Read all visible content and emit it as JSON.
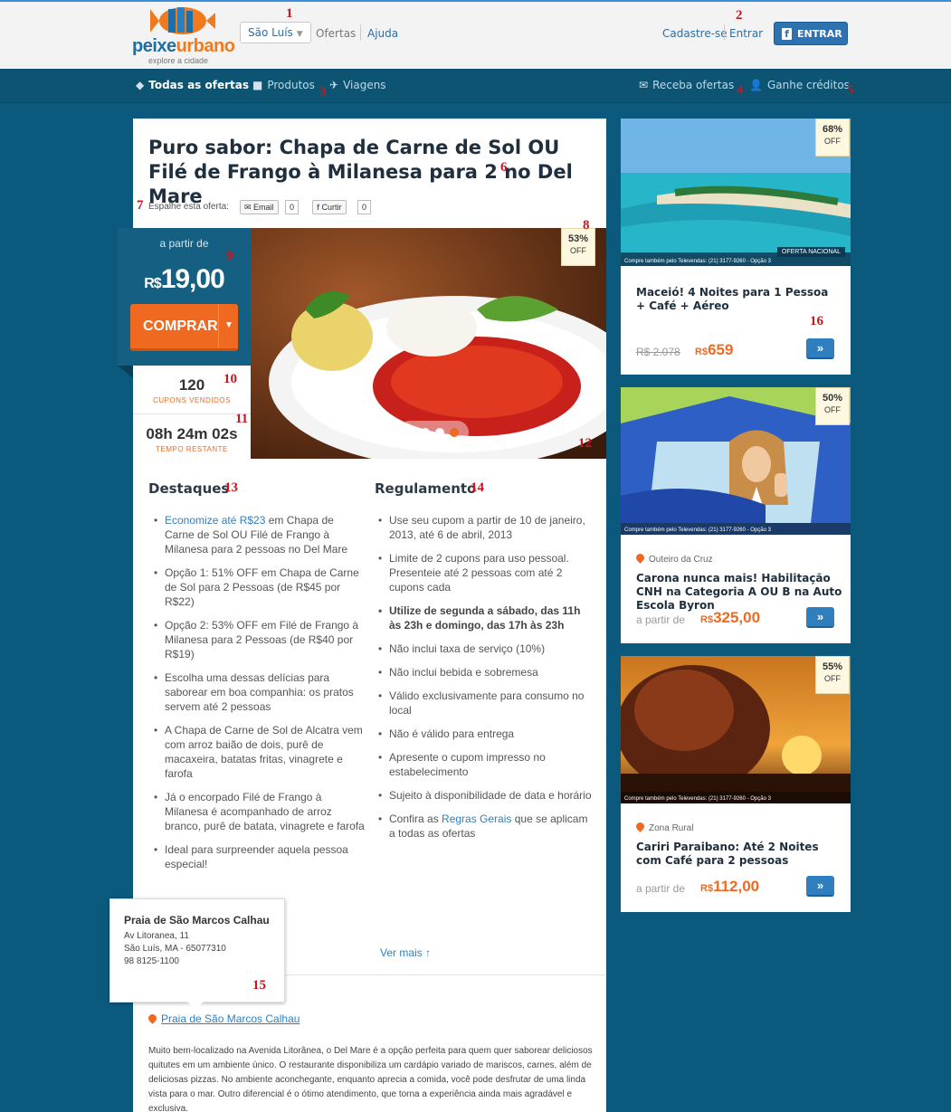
{
  "header": {
    "logo_main_a": "peixe",
    "logo_main_b": "urbano",
    "logo_sub": "explore a cidade",
    "city": "São Luís",
    "ofertas": "Ofertas",
    "ajuda": "Ajuda",
    "cadastre": "Cadastre-se",
    "entrar": "Entrar",
    "entrar_button": "ENTRAR"
  },
  "nav": {
    "todas": "Todas as ofertas",
    "produtos": "Produtos",
    "viagens": "Viagens",
    "receba": "Receba ofertas",
    "ganhe": "Ganhe créditos"
  },
  "annotations": [
    "1",
    "2",
    "3",
    "4",
    "5",
    "6",
    "7",
    "8",
    "9",
    "10",
    "11",
    "12",
    "13",
    "14",
    "15",
    "16"
  ],
  "deal": {
    "title": "Puro sabor: Chapa de Carne de Sol OU Filé de Frango à Milanesa para 2 no Del Mare",
    "share_label": "Espalhe esta oferta:",
    "email": "Email",
    "email_count": "0",
    "curtir": "Curtir",
    "curtir_count": "0",
    "a_partir": "a partir de",
    "currency": "R$",
    "price": "19,00",
    "comprar": "COMPRAR",
    "discount": "53%",
    "off": "OFF",
    "sold": "120",
    "sold_label": "CUPONS VENDIDOS",
    "time": "08h 24m 02s",
    "time_label": "TEMPO RESTANTE"
  },
  "destaques": {
    "heading": "Destaques",
    "first_link": "Economize até R$23",
    "first_rest": " em Chapa de Carne de Sol OU Filé de Frango à Milanesa para 2 pessoas no Del Mare",
    "items": [
      "Opção 1: 51% OFF em Chapa de Carne de Sol para 2 Pessoas (de R$45 por R$22)",
      "Opção 2: 53% OFF em Filé de Frango à Milanesa para 2 Pessoas (de R$40 por R$19)",
      "Escolha uma dessas delícias para saborear em boa companhia: os pratos servem até 2 pessoas",
      "A Chapa de Carne de Sol de Alcatra vem com arroz baião de dois, purê de macaxeira, batatas fritas, vinagrete e farofa",
      "Já o encorpado Filé de Frango à Milanesa é acompanhado de arroz branco, purê de batata, vinagrete e farofa",
      "Ideal para surpreender aquela pessoa especial!"
    ]
  },
  "regulamento": {
    "heading": "Regulamento",
    "items": [
      "Use seu cupom a partir de 10 de janeiro, 2013, até 6 de abril, 2013",
      "Limite de 2 cupons para uso pessoal. Presenteie até 2 pessoas com até 2 cupons cada",
      "Utilize de segunda a sábado, das 11h às 23h e domingo, das 17h às 23h",
      "Não inclui taxa de serviço (10%)",
      "Não inclui bebida e sobremesa",
      "Válido exclusivamente para consumo no local",
      "Não é válido para entrega",
      "Apresente o cupom impresso no estabelecimento",
      "Sujeito à disponibilidade de data e horário"
    ],
    "last_pre": "Confira as ",
    "last_link": "Regras Gerais",
    "last_post": " que se aplicam a todas as ofertas"
  },
  "ver_mais": "Ver mais ↑",
  "popup": {
    "name": "Praia de São Marcos Calhau",
    "address": "Av Litoranea, 11",
    "city": "São Luís, MA - 65077310",
    "phone": "98 8125-1100"
  },
  "location_link": "Praia de São Marcos Calhau",
  "description": "Muito bem-localizado na Avenida Litorânea, o Del Mare é a opção perfeita para quem quer saborear deliciosos quitutes em um ambiente único. O restaurante disponibiliza um cardápio variado de mariscos, carnes, além de deliciosas pizzas. No ambiente aconchegante, enquanto aprecia a comida, você pode desfrutar de uma linda vista para o mar. Outro diferencial é o ótimo atendimento, que torna a experiência ainda mais agradável e exclusiva.",
  "side": [
    {
      "discount": "68%",
      "off": "OFF",
      "tag": "OFERTA NACIONAL",
      "tele": "Compre também pelo Televendas: (21) 3177-9260 - Opção 3",
      "title": "Maceió! 4 Noites para 1 Pessoa + Café + Aéreo",
      "old_price": "R$ 2.078",
      "currency": "R$",
      "price": "659",
      "go": "»"
    },
    {
      "discount": "50%",
      "off": "OFF",
      "tele": "Compre também pelo Televendas: (21) 3177-9260 - Opção 3",
      "location": "Outeiro da Cruz",
      "title": "Carona nunca mais! Habilitação CNH na Categoria A OU B na Auto Escola Byron",
      "a_partir": "a partir de",
      "currency": "R$",
      "price": "325,00",
      "go": "»"
    },
    {
      "discount": "55%",
      "off": "OFF",
      "tele": "Compre também pelo Televendas: (21) 3177-9260 - Opção 3",
      "location": "Zona Rural",
      "title": "Cariri Paraibano: Até 2 Noites com Café para 2 pessoas",
      "a_partir": "a partir de",
      "currency": "R$",
      "price": "112,00",
      "go": "»"
    }
  ]
}
